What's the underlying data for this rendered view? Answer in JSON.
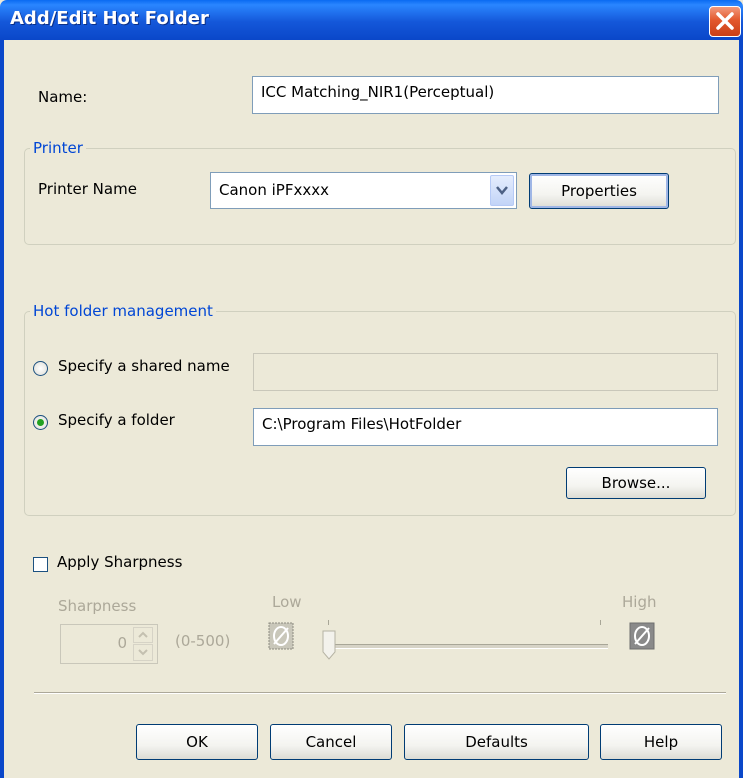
{
  "window": {
    "title": "Add/Edit Hot Folder"
  },
  "name_field": {
    "label": "Name:",
    "value": "ICC Matching_NIR1(Perceptual)"
  },
  "printer_group": {
    "legend": "Printer",
    "printer_name_label": "Printer Name",
    "printer_select_value": "Canon iPFxxxx",
    "properties_label": "Properties"
  },
  "hot_folder_group": {
    "legend": "Hot folder management",
    "shared_name_radio_label": "Specify a shared name",
    "shared_name_value": "",
    "folder_radio_label": "Specify a folder",
    "folder_path": "C:\\Program Files\\HotFolder",
    "browse_label": "Browse...",
    "selected_option": "Specify a folder"
  },
  "sharpness": {
    "checkbox_label": "Apply Sharpness",
    "checked": false,
    "spinner_label": "Sharpness",
    "value": "0",
    "range_label": "(0-500)",
    "slider_low_label": "Low",
    "slider_high_label": "High",
    "slider_level": 0
  },
  "footer": {
    "ok_label": "OK",
    "cancel_label": "Cancel",
    "defaults_label": "Defaults",
    "help_label": "Help"
  },
  "colors": {
    "titlebar": "#0a47c9",
    "dialog_bg": "#ece9d8",
    "group_legend": "#0046d5",
    "close_button": "#e3582d"
  }
}
